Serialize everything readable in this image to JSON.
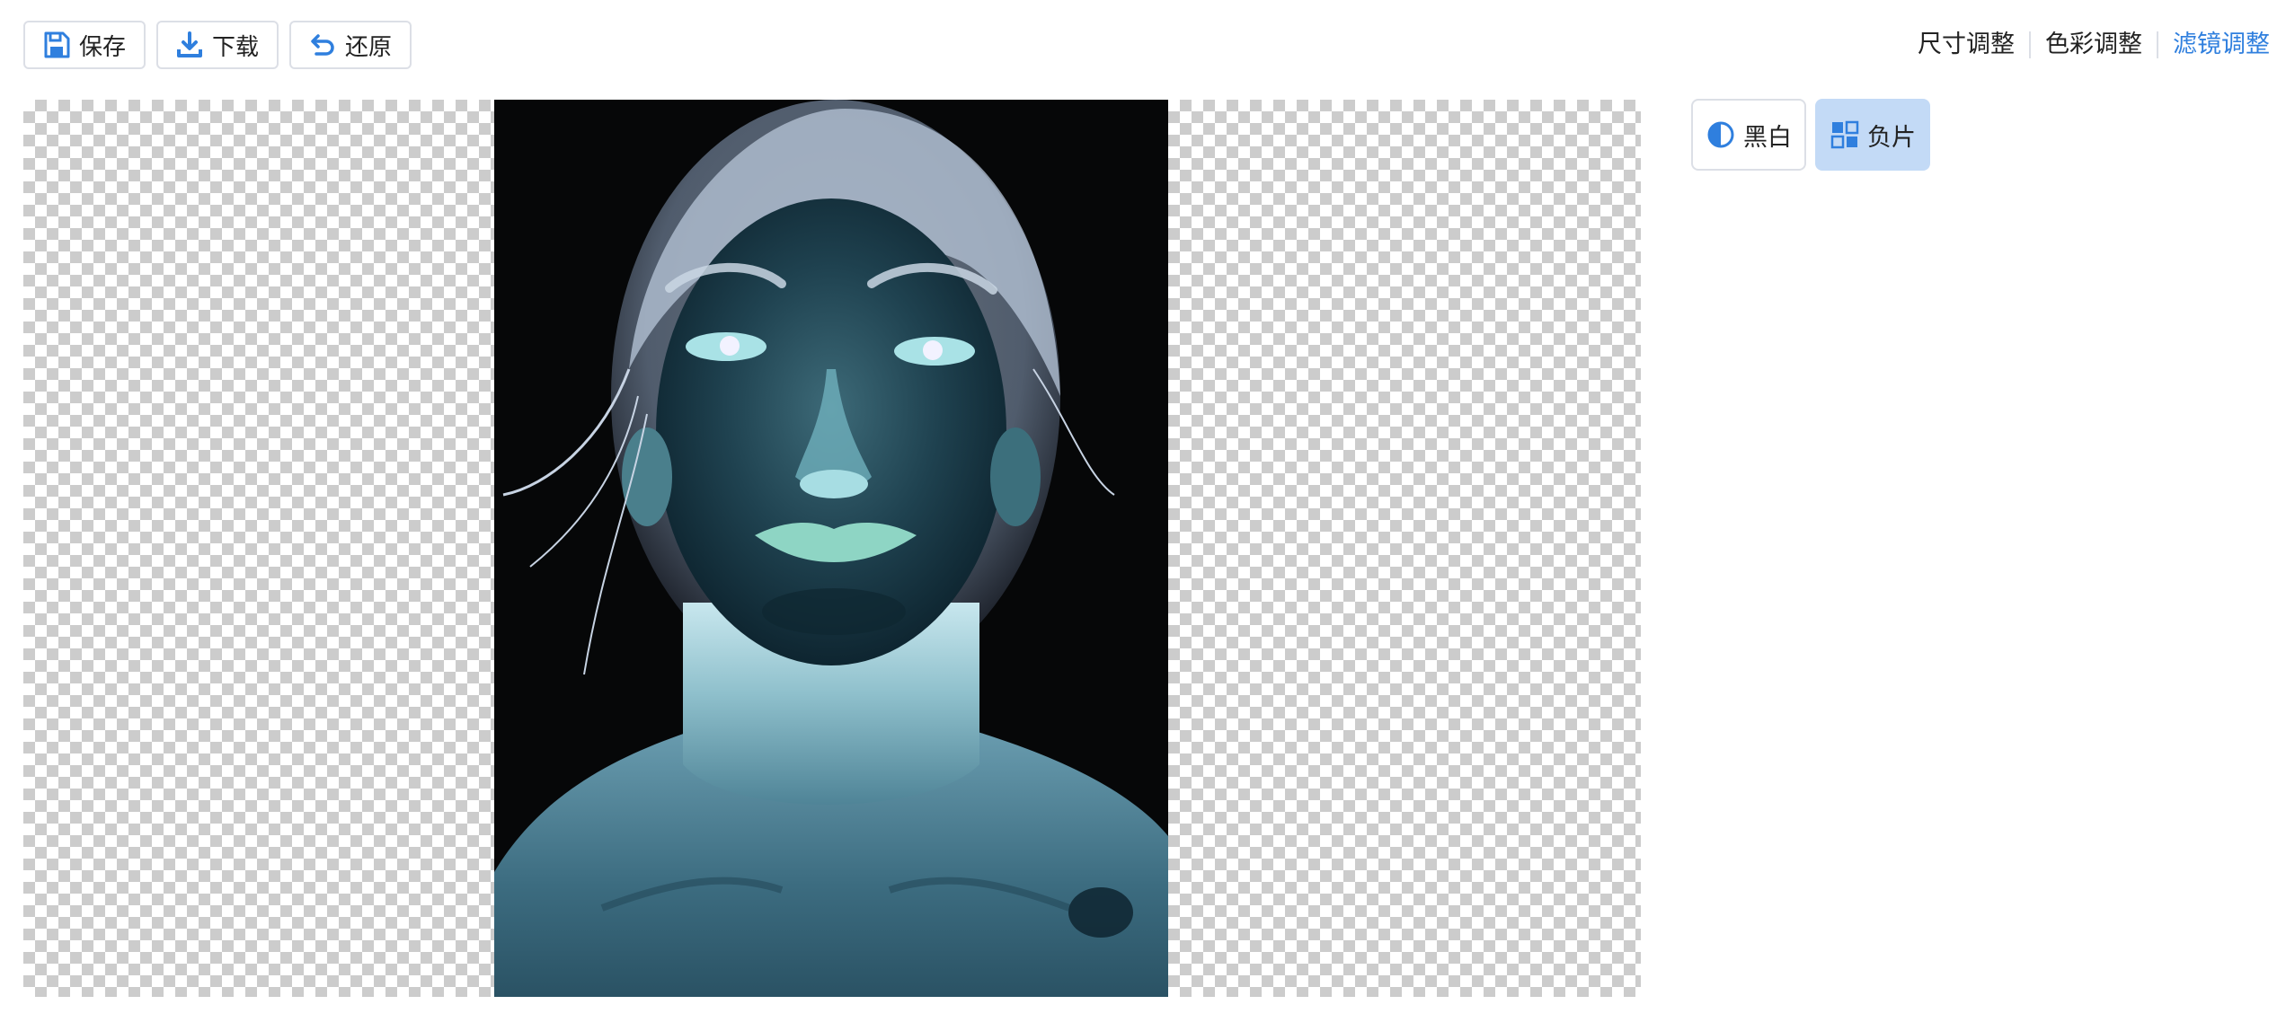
{
  "toolbar": {
    "buttons": [
      {
        "label": "保存",
        "icon": "save-icon"
      },
      {
        "label": "下载",
        "icon": "download-icon"
      },
      {
        "label": "还原",
        "icon": "undo-icon"
      }
    ]
  },
  "tabs": [
    {
      "label": "尺寸调整",
      "active": false
    },
    {
      "label": "色彩调整",
      "active": false
    },
    {
      "label": "滤镜调整",
      "active": true
    }
  ],
  "filters": [
    {
      "label": "黑白",
      "icon": "contrast-icon",
      "selected": false
    },
    {
      "label": "负片",
      "icon": "negative-icon",
      "selected": true
    }
  ],
  "colors": {
    "accent": "#2f7fde",
    "selected_bg": "#c3daf6",
    "border": "#dcdfe6",
    "checker": "#cccccc"
  }
}
